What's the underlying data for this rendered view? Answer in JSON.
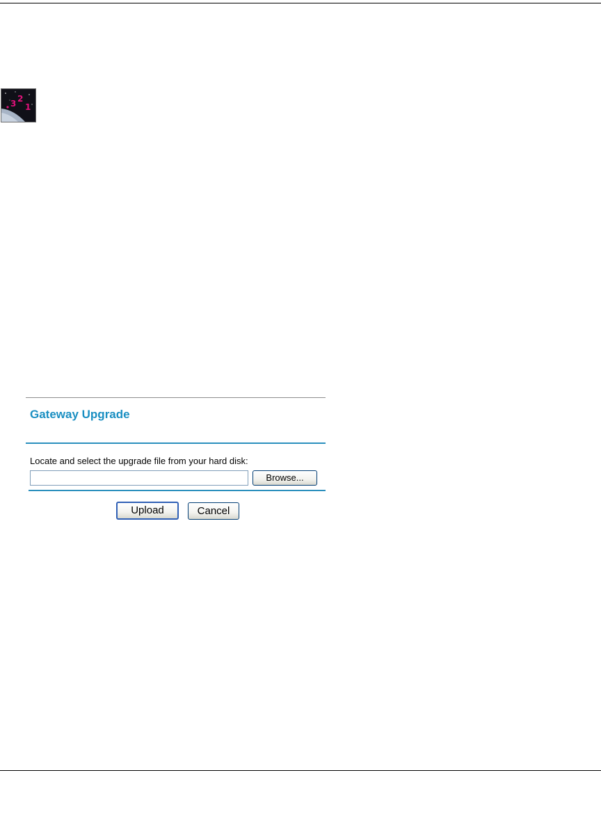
{
  "page": {
    "icon_name": "version-countdown-icon"
  },
  "gateway_upgrade": {
    "title": "Gateway Upgrade",
    "instruction": "Locate and select the upgrade file from your hard disk:",
    "file_input": {
      "value": "",
      "placeholder": ""
    },
    "browse_label": "Browse...",
    "upload_label": "Upload",
    "cancel_label": "Cancel"
  },
  "colors": {
    "title": "#1a8fc2",
    "rule": "#2a8fbd",
    "button_border": "#003c74",
    "default_button_border": "#2f5fb5"
  }
}
